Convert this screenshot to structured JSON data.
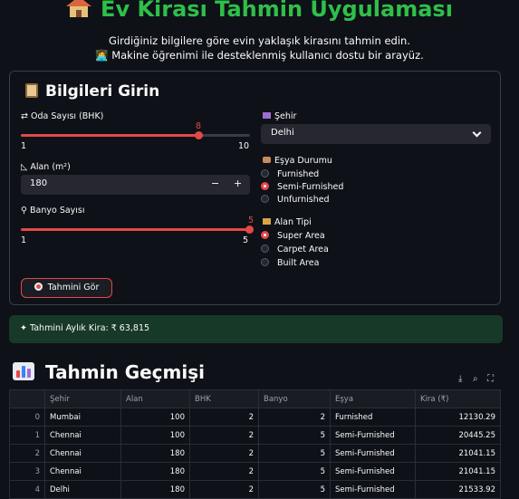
{
  "app": {
    "title": "Ev Kirası Tahmin Uygulaması",
    "subtitle1": "Girdiğiniz bilgilere göre evin yaklaşık kirasını tahmin edin.",
    "subtitle2": "👩‍💻 Makine öğrenimi ile desteklenmiş kullanıcı dostu bir arayüz."
  },
  "form": {
    "title": "Bilgileri Girin",
    "bhk": {
      "label": "Oda Sayısı (BHK)",
      "value": "8",
      "min": "1",
      "max": "10",
      "fraction": 0.778
    },
    "area": {
      "label": "Alan (m²)",
      "value": "180",
      "minus": "−",
      "plus": "+"
    },
    "bath": {
      "label": "Banyo Sayısı",
      "value": "5",
      "min": "1",
      "max": "5",
      "fraction": 1.0
    },
    "city": {
      "label": "Şehir",
      "value": "Delhi"
    },
    "furnish": {
      "label": "Eşya Durumu",
      "options": [
        "Furnished",
        "Semi-Furnished",
        "Unfurnished"
      ],
      "selected": "Semi-Furnished"
    },
    "areatype": {
      "label": "Alan Tipi",
      "options": [
        "Super Area",
        "Carpet Area",
        "Built Area"
      ],
      "selected": "Super Area"
    },
    "button": "Tahmini Gör"
  },
  "result": {
    "text": "Tahmini Aylık Kira: ₹ 63,815"
  },
  "history": {
    "title": "Tahmin Geçmişi",
    "toolbar": {
      "download": "⤓",
      "search": "⌕",
      "fullscreen": "⛶"
    },
    "columns": [
      "",
      "Şehir",
      "Alan",
      "BHK",
      "Banyo",
      "Eşya",
      "Kira (₹)"
    ],
    "rows": [
      [
        "0",
        "Mumbai",
        "100",
        "2",
        "2",
        "Furnished",
        "12130.29"
      ],
      [
        "1",
        "Chennai",
        "100",
        "2",
        "5",
        "Semi-Furnished",
        "20445.25"
      ],
      [
        "2",
        "Chennai",
        "180",
        "2",
        "5",
        "Semi-Furnished",
        "21041.15"
      ],
      [
        "3",
        "Chennai",
        "180",
        "2",
        "5",
        "Semi-Furnished",
        "21041.15"
      ],
      [
        "4",
        "Delhi",
        "180",
        "2",
        "5",
        "Semi-Furnished",
        "21533.92"
      ]
    ]
  },
  "colors": {
    "accent": "#e54848",
    "title_green": "#2fbf4a",
    "success_bg": "#173927",
    "bg": "#0e1117"
  }
}
